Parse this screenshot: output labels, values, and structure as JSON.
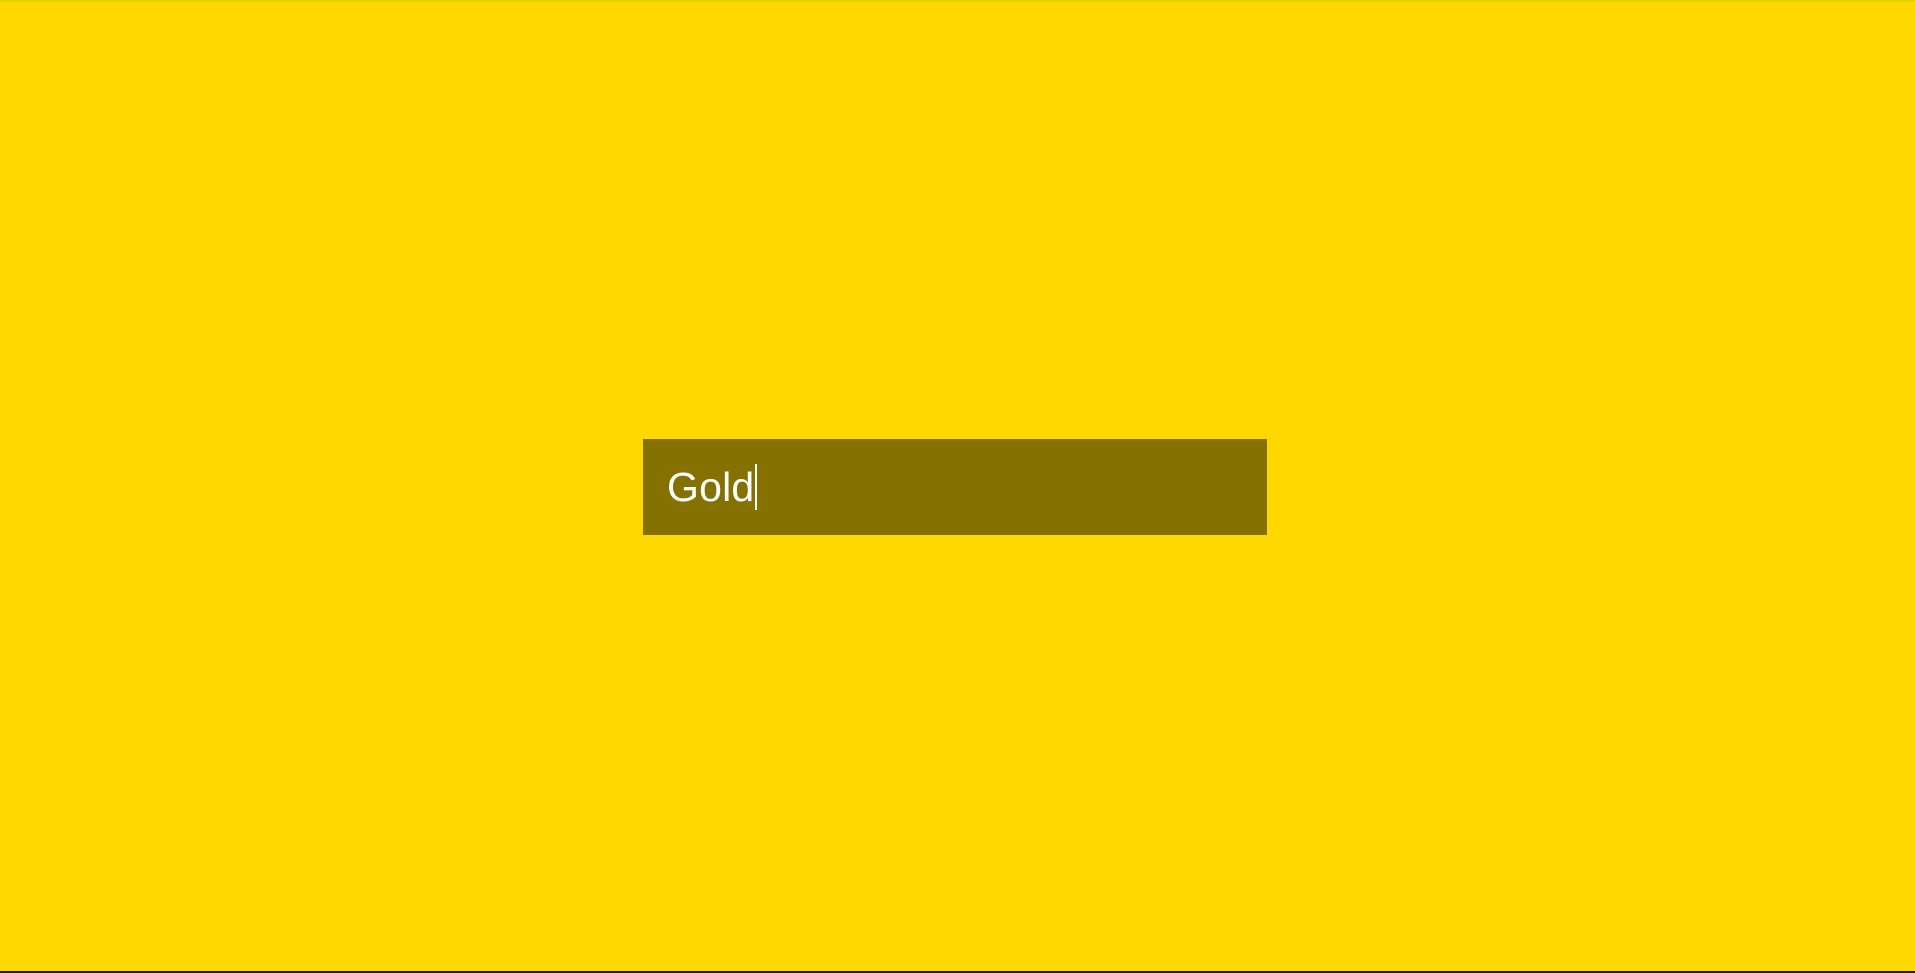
{
  "colors": {
    "background": "#ffd800",
    "field_background": "#857100",
    "text": "#ffffff"
  },
  "color_input": {
    "value": "Gold"
  }
}
